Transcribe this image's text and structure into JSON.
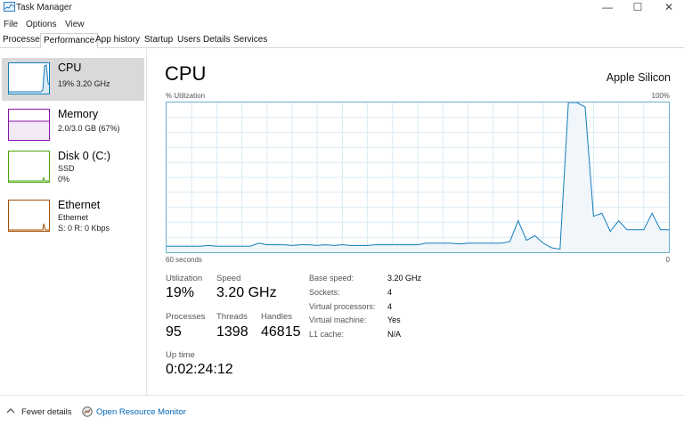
{
  "window": {
    "title": "Task Manager",
    "controls": {
      "minimize": "—",
      "maximize": "☐",
      "close": "✕"
    }
  },
  "menu": [
    "File",
    "Options",
    "View"
  ],
  "tabs": [
    "Processes",
    "Performance",
    "App history",
    "Startup",
    "Users",
    "Details",
    "Services"
  ],
  "active_tab": "Performance",
  "sidebar": {
    "items": [
      {
        "title": "CPU",
        "sub1": "19%  3.20 GHz",
        "sub2": "",
        "sub3": "",
        "color": "#117dbb",
        "selected": true
      },
      {
        "title": "Memory",
        "sub1": "2.0/3.0 GB (67%)",
        "sub2": "",
        "sub3": "",
        "color": "#8b12ae",
        "selected": false
      },
      {
        "title": "Disk 0 (C:)",
        "sub1": "SSD",
        "sub2": "0%",
        "sub3": "",
        "color": "#4da60c",
        "selected": false
      },
      {
        "title": "Ethernet",
        "sub1": "Ethernet",
        "sub2": "S: 0  R: 0 Kbps",
        "sub3": "",
        "color": "#a74f01",
        "selected": false
      }
    ]
  },
  "main": {
    "title": "CPU",
    "processor": "Apple Silicon",
    "graph": {
      "top_left_label": "% Utilization",
      "top_right_label": "100%",
      "bottom_left_label": "60 seconds",
      "bottom_right_label": "0",
      "line_color": "#117dbb",
      "fill_color": "#f1f6fa"
    },
    "stats": {
      "utilization_label": "Utilization",
      "utilization_value": "19%",
      "speed_label": "Speed",
      "speed_value": "3.20 GHz",
      "processes_label": "Processes",
      "processes_value": "95",
      "threads_label": "Threads",
      "threads_value": "1398",
      "handles_label": "Handles",
      "handles_value": "46815",
      "uptime_label": "Up time",
      "uptime_value": "0:02:24:12"
    },
    "specs": [
      {
        "label": "Base speed:",
        "value": "3.20 GHz"
      },
      {
        "label": "Sockets:",
        "value": "4"
      },
      {
        "label": "Virtual processors:",
        "value": "4"
      },
      {
        "label": "Virtual machine:",
        "value": "Yes"
      },
      {
        "label": "L1 cache:",
        "value": "N/A"
      }
    ]
  },
  "footer": {
    "fewer_details": "Fewer details",
    "open_resource_monitor": "Open Resource Monitor"
  },
  "chart_data": {
    "type": "area",
    "title": "",
    "xlabel": "60 seconds",
    "ylabel": "% Utilization",
    "xlim": [
      60,
      0
    ],
    "ylim": [
      0,
      100
    ],
    "grid": true,
    "x": [
      60,
      59,
      58,
      57,
      56,
      55,
      54,
      53,
      52,
      51,
      50,
      49,
      48,
      47,
      46,
      45,
      44,
      43,
      42,
      41,
      40,
      39,
      38,
      37,
      36,
      35,
      34,
      33,
      32,
      31,
      30,
      29,
      28,
      27,
      26,
      25,
      24,
      23,
      22,
      21,
      20,
      19,
      18,
      17,
      16,
      15,
      14,
      13,
      12,
      11,
      10,
      9,
      8,
      7,
      6,
      5,
      4,
      3,
      2,
      1,
      0
    ],
    "series": [
      {
        "values": [
          4,
          4,
          4,
          4,
          4,
          4.5,
          4,
          4,
          4,
          4,
          4,
          6,
          5,
          5,
          5,
          4.5,
          5,
          5,
          4.5,
          5,
          4.5,
          5,
          4.5,
          4.5,
          4.5,
          5,
          5,
          5,
          5,
          5,
          5,
          6,
          6,
          6,
          6,
          5.5,
          6,
          6,
          6,
          6,
          6,
          7,
          21,
          8,
          11,
          6,
          3,
          2,
          100,
          100,
          97,
          24,
          26,
          14,
          21,
          15,
          15,
          15,
          26,
          15,
          15
        ]
      }
    ]
  }
}
